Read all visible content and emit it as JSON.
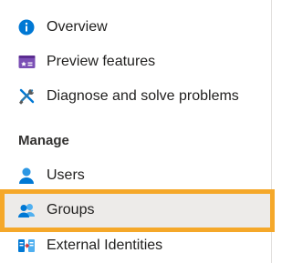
{
  "nav": {
    "items": [
      {
        "label": "Overview",
        "icon": "info-icon"
      },
      {
        "label": "Preview features",
        "icon": "preview-features-icon"
      },
      {
        "label": "Diagnose and solve problems",
        "icon": "wrench-screwdriver-icon"
      }
    ],
    "manage_heading": "Manage",
    "manage_items": [
      {
        "label": "Users",
        "icon": "user-icon"
      },
      {
        "label": "Groups",
        "icon": "groups-icon",
        "selected": true
      },
      {
        "label": "External Identities",
        "icon": "external-identities-icon"
      }
    ]
  },
  "colors": {
    "accent_blue": "#0078d4",
    "highlight_orange": "#f5a82a",
    "preview_purple": "#7b4fb5",
    "selected_bg": "#edebe9"
  }
}
